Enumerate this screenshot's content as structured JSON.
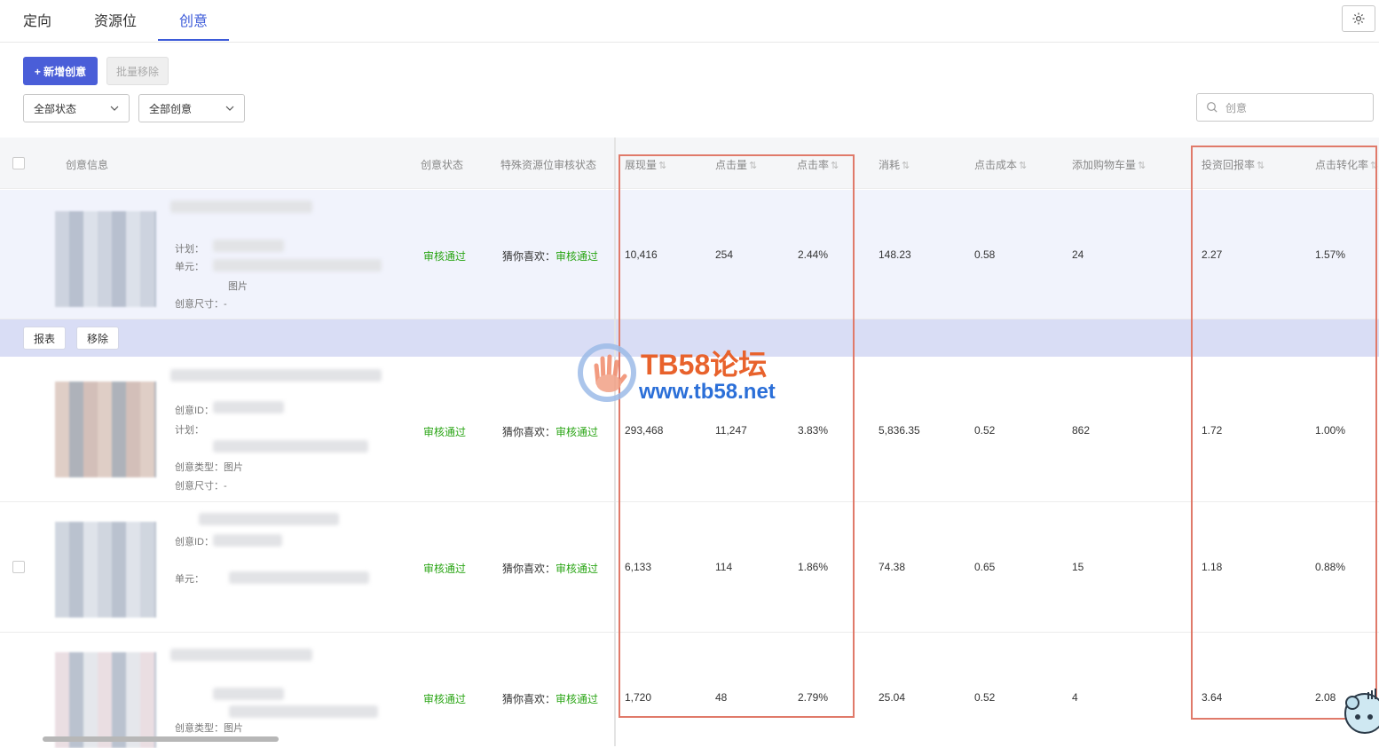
{
  "tabs": [
    "定向",
    "资源位",
    "创意"
  ],
  "toolbar": {
    "add_label": "+ 新增创意",
    "batch_remove_label": "批量移除"
  },
  "filters": {
    "status": "全部状态",
    "creative": "全部创意",
    "search_placeholder": "创意"
  },
  "columns": {
    "info": "创意信息",
    "status": "创意状态",
    "special": "特殊资源位审核状态",
    "impressions": "展现量",
    "clicks": "点击量",
    "ctr": "点击率",
    "cost": "消耗",
    "cpc": "点击成本",
    "cart": "添加购物车量",
    "roi": "投资回报率",
    "cvr": "点击转化率"
  },
  "meta_labels": {
    "plan": "计划：",
    "unit": "单元：",
    "size": "创意尺寸：-",
    "id": "创意ID：",
    "type": "创意类型：图片",
    "img": "图片"
  },
  "rows": [
    {
      "status": "审核通过",
      "special_prefix": "猜你喜欢：",
      "special_status": "审核通过",
      "impressions": "10,416",
      "clicks": "254",
      "ctr": "2.44%",
      "cost": "148.23",
      "cpc": "0.58",
      "cart": "24",
      "roi": "2.27",
      "cvr": "1.57%"
    },
    {
      "status": "审核通过",
      "special_prefix": "猜你喜欢：",
      "special_status": "审核通过",
      "impressions": "293,468",
      "clicks": "11,247",
      "ctr": "3.83%",
      "cost": "5,836.35",
      "cpc": "0.52",
      "cart": "862",
      "roi": "1.72",
      "cvr": "1.00%"
    },
    {
      "status": "审核通过",
      "special_prefix": "猜你喜欢：",
      "special_status": "审核通过",
      "impressions": "6,133",
      "clicks": "114",
      "ctr": "1.86%",
      "cost": "74.38",
      "cpc": "0.65",
      "cart": "15",
      "roi": "1.18",
      "cvr": "0.88%"
    },
    {
      "status": "审核通过",
      "special_prefix": "猜你喜欢：",
      "special_status": "审核通过",
      "impressions": "1,720",
      "clicks": "48",
      "ctr": "2.79%",
      "cost": "25.04",
      "cpc": "0.52",
      "cart": "4",
      "roi": "3.64",
      "cvr": "2.08"
    }
  ],
  "row_actions": {
    "report": "报表",
    "remove": "移除"
  },
  "watermark": {
    "title": "TB58论坛",
    "url": "www.tb58.net"
  },
  "colors": {
    "accent": "#3d5bd9",
    "approved": "#2aa515",
    "annotation": "#e07a6a"
  }
}
